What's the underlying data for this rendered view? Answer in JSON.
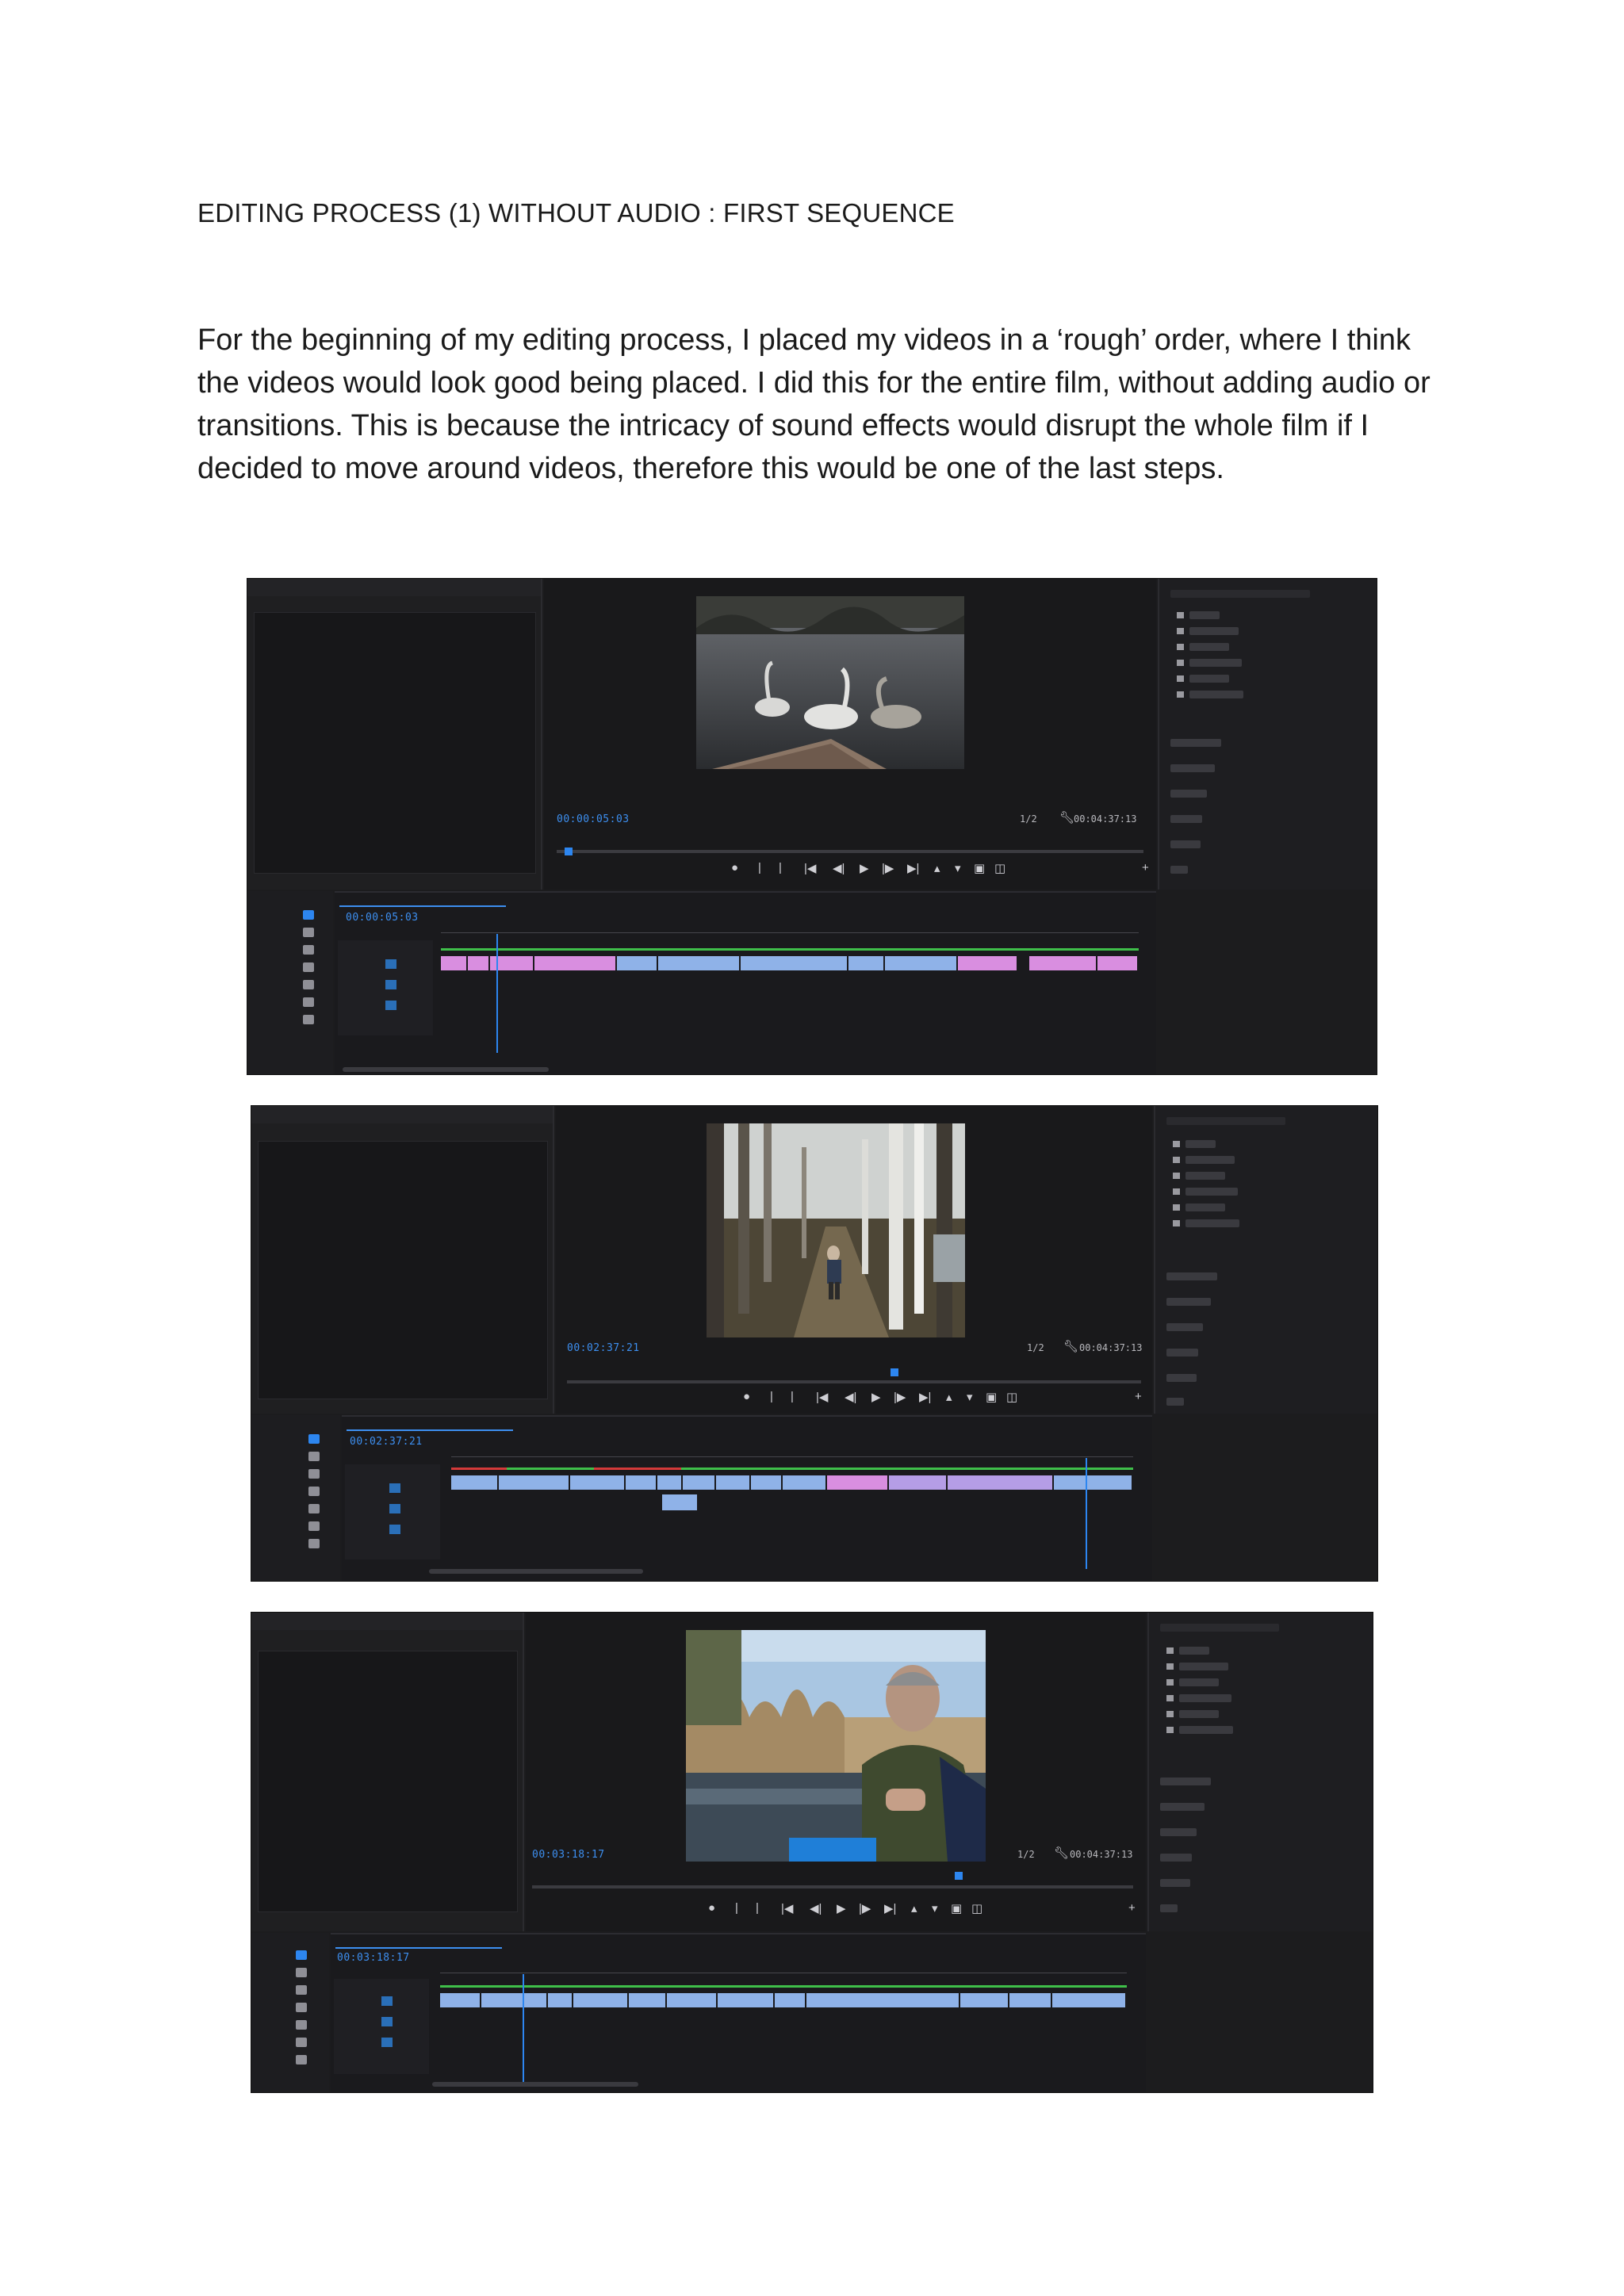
{
  "heading": "EDITING PROCESS (1) WITHOUT AUDIO : FIRST SEQUENCE",
  "paragraph": "For the beginning of my editing process, I placed my videos in a ‘rough’ order, where I think the videos would look good being placed. I did this for the entire film, without adding audio or transitions. This is because the intricacy of sound effects would disrupt the whole film if I decided to move around videos, therefore this would be one of the last steps.",
  "screenshots": [
    {
      "timecode_current": "00:00:05:03",
      "timecode_total": "00:04:37:13",
      "timeline_timecode": "00:00:05:03",
      "fit": "1/2",
      "video_subject": "swans on a pond seen from a boat bow",
      "playhead_progress": 0.02,
      "timeline_playhead_progress": 0.08
    },
    {
      "timecode_current": "00:02:37:21",
      "timecode_total": "00:04:37:13",
      "timeline_timecode": "00:02:37:21",
      "fit": "1/2",
      "video_subject": "person walking on a woodland path between birch trees",
      "playhead_progress": 0.57,
      "timeline_playhead_progress": 0.93
    },
    {
      "timecode_current": "00:03:18:17",
      "timecode_total": "00:04:37:13",
      "timeline_timecode": "00:03:18:17",
      "fit": "1/2",
      "video_subject": "man fishing beside reeds and water",
      "playhead_progress": 0.71,
      "timeline_playhead_progress": 0.12
    }
  ],
  "colors": {
    "ui_bg": "#1c1c1e",
    "accent_blue": "#2d86f0",
    "clip_pink": "#d98ee0",
    "clip_blue": "#8fb2e8",
    "clip_lavender": "#b59de6",
    "track_green": "#3fbf4a"
  },
  "icons": [
    "play-icon",
    "step-back-icon",
    "step-forward-icon",
    "mark-in-icon",
    "mark-out-icon",
    "camera-icon",
    "wrench-icon",
    "selection-tool-icon",
    "razor-tool-icon",
    "pen-tool-icon"
  ]
}
